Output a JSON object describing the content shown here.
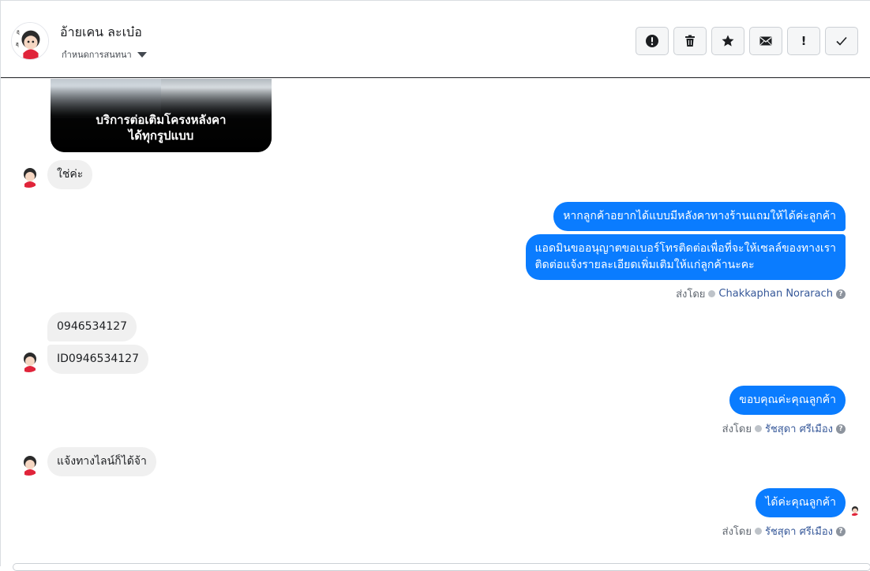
{
  "header": {
    "contact_name": "อ้ายเคน ละเบ๋อ",
    "assign_label": "กำหนดการสนทนา",
    "actions": [
      {
        "name": "spam-button",
        "icon": "alert-circle-icon"
      },
      {
        "name": "delete-button",
        "icon": "trash-icon"
      },
      {
        "name": "star-button",
        "icon": "star-icon"
      },
      {
        "name": "mark-unread-button",
        "icon": "envelope-icon"
      },
      {
        "name": "follow-up-button",
        "icon": "exclamation-icon"
      },
      {
        "name": "mark-done-button",
        "icon": "check-icon"
      }
    ]
  },
  "thread": {
    "card_caption_line1": "บริการต่อเติมโครงหลังคา",
    "card_caption_line2": "ได้ทุกรูปแบบ",
    "messages": {
      "m1": "ใช่ค่ะ",
      "m2": "หากลูกค้าอยากได้แบบมีหลังคาทางร้านแถมให้ได้ค่ะลูกค้า",
      "m3_line1": "แอดมินขออนุญาตขอเบอร์โทรติดต่อเพื่อที่จะให้เซลล์ของทางเรา",
      "m3_line2": "ติดต่อแจ้งรายละเอียดเพิ่มเติมให้แก่ลูกค้านะคะ",
      "m4": "0946534127",
      "m5": "ID0946534127",
      "m6": "ขอบคุณค่ะคุณลูกค้า",
      "m7": "แจ้งทางไลน์ก็ได้จ้า",
      "m8": "ได้ค่ะคุณลูกค้า"
    },
    "sent_by_label": "ส่งโดย",
    "agents": {
      "agent1": "Chakkaphan Norarach",
      "agent2": "รัชสุดา ศรีเมือง",
      "agent3": "รัชสุดา ศรีเมือง"
    },
    "help_glyph": "?",
    "excl_glyph": "!"
  },
  "colors": {
    "outgoing_bubble": "#0a7cff",
    "incoming_bubble": "#f0f0f0",
    "agent_link": "#365899"
  }
}
